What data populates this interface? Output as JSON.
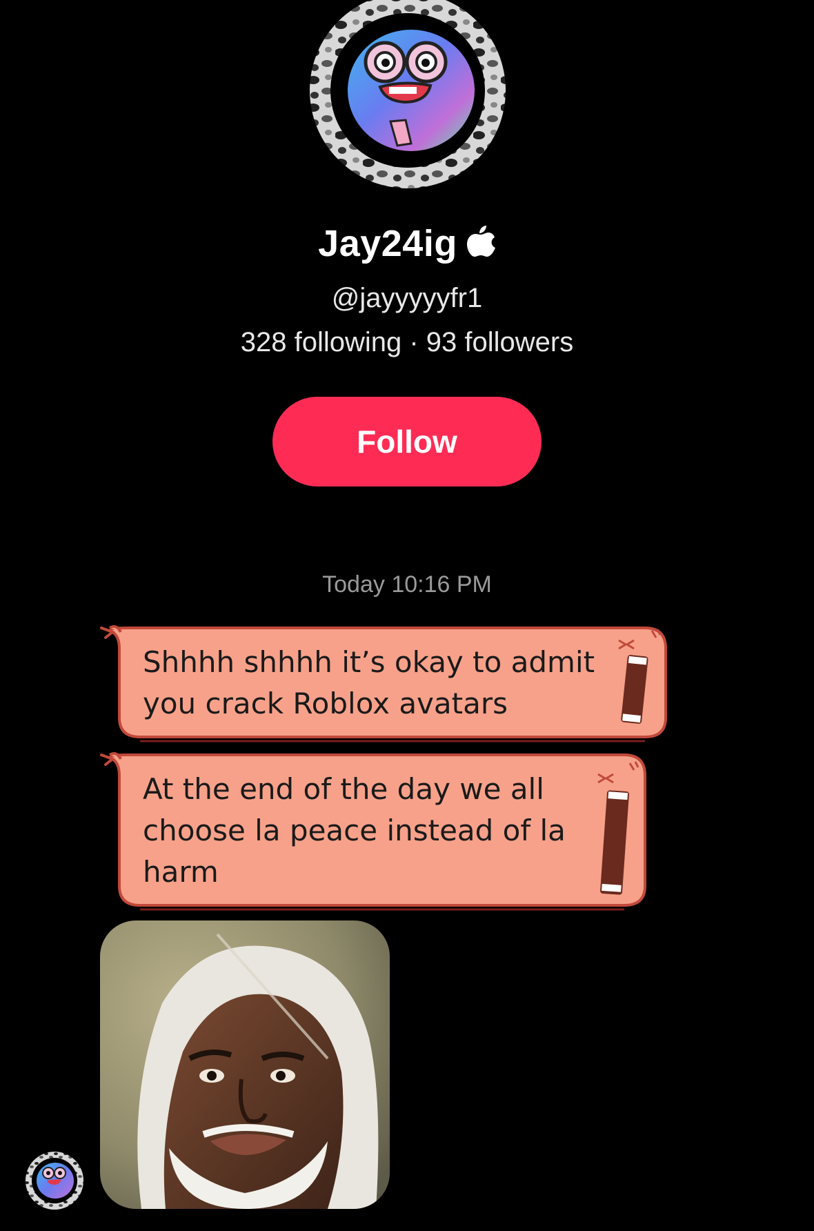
{
  "profile": {
    "display_name": "Jay24ig",
    "badge_icon": "apple-icon",
    "handle": "@jayyyyyfr1",
    "stats": "328 following · 93 followers",
    "follow_label": "Follow"
  },
  "conversation": {
    "timestamp": "Today 10:16 PM",
    "messages": [
      {
        "text": "Shhhh shhhh it’s okay to admit\nyou crack Roblox avatars"
      },
      {
        "text": "At the end of the day we all\nchoose la peace instead of la\nharm"
      }
    ],
    "image_message": {
      "icon": "meme-image"
    }
  },
  "colors": {
    "background": "#000000",
    "follow_button": "#fe2c55",
    "bubble_fill": "#f7a18a",
    "bubble_outline": "#c2493a",
    "timestamp_text": "#9a9a9a"
  }
}
